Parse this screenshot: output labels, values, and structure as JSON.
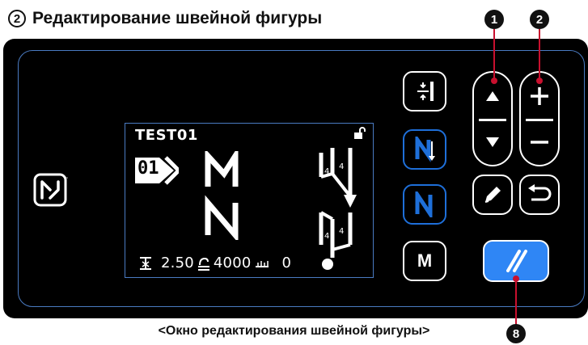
{
  "heading": {
    "step_number": "2",
    "title": "Редактирование швейной фигуры"
  },
  "callouts": {
    "one": "1",
    "two": "2",
    "eight": "8"
  },
  "lcd": {
    "program_name": "TEST01",
    "pattern_number": "01",
    "stitch_length": "2.50",
    "speed": "4000",
    "count": "0"
  },
  "buttons": {
    "menu_label": "M"
  },
  "caption": "<Окно редактирования швейной фигуры>",
  "colors": {
    "panel_bg": "#000000",
    "panel_border": "#4a7bc2",
    "clear_button": "#2f86f5",
    "callout_line": "#c8102e"
  },
  "icons": [
    "nfc-icon",
    "stitch-length-icon",
    "reverse-bar-icon",
    "normal-bar-icon",
    "up-arrow-icon",
    "down-arrow-icon",
    "plus-icon",
    "minus-icon",
    "edit-icon",
    "return-icon",
    "clear-icon",
    "lock-icon"
  ]
}
